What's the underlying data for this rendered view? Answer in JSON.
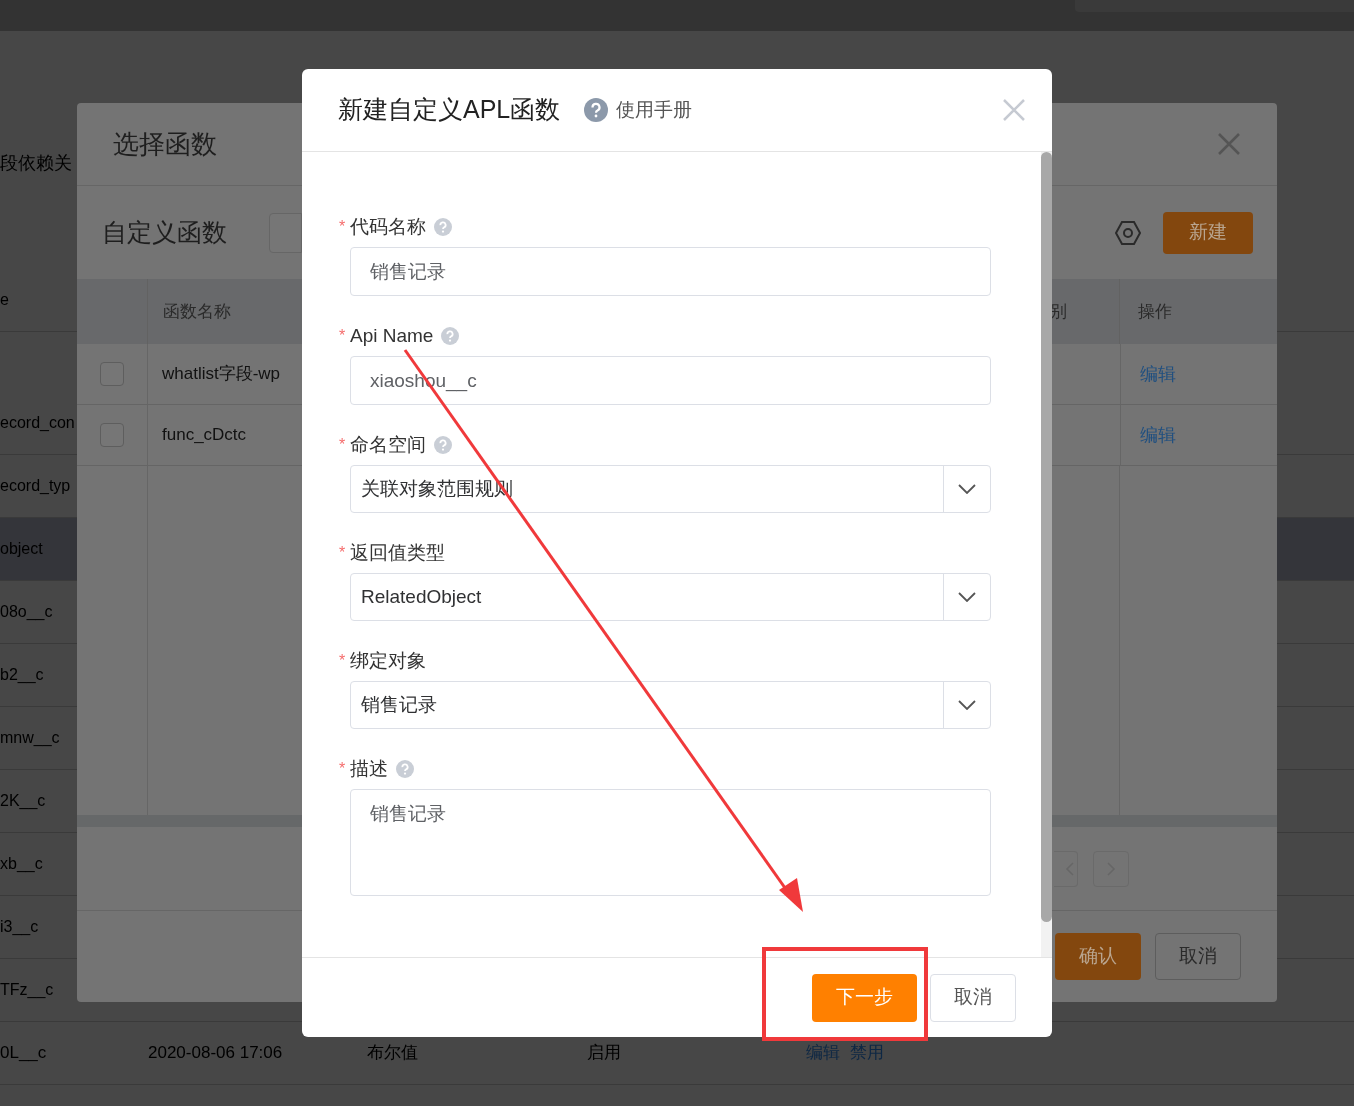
{
  "background_page": {
    "heading_fragment": "段依赖关",
    "rows": [
      {
        "text": "e",
        "selected": false
      },
      {
        "text": "ecord_con",
        "selected": false
      },
      {
        "text": "ecord_typ",
        "selected": false
      },
      {
        "text": "object",
        "selected": true
      },
      {
        "text": "08o__c",
        "selected": false
      },
      {
        "text": "b2__c",
        "selected": false
      },
      {
        "text": "mnw__c",
        "selected": false
      },
      {
        "text": "2K__c",
        "selected": false
      },
      {
        "text": "xb__c",
        "selected": false
      },
      {
        "text": "i3__c",
        "selected": false
      },
      {
        "text": "TFz__c",
        "selected": false
      }
    ],
    "bottom_row": {
      "name": "0L__c",
      "time": "2020-08-06 17:06",
      "type": "布尔值",
      "status": "启用",
      "actions": [
        "编辑",
        "禁用"
      ]
    }
  },
  "select_function_dialog": {
    "title": "选择函数",
    "section_title": "自定义函数",
    "new_button": "新建",
    "columns": [
      "函数名称",
      "别",
      "操作"
    ],
    "rows": [
      {
        "name": "whatlist字段-wp",
        "action": "编辑",
        "checked": false
      },
      {
        "name": "func_cDctc",
        "action": "编辑",
        "checked": false
      }
    ],
    "buttons": [
      "确认",
      "取消"
    ]
  },
  "create_dialog": {
    "title": "新建自定义APL函数",
    "help_link": "使用手册",
    "fields": [
      {
        "kind": "input",
        "required_mark": "*",
        "label": "代码名称",
        "help": true,
        "value": "销售记录"
      },
      {
        "kind": "input",
        "required_mark": "*",
        "label": "Api Name",
        "help": true,
        "value": "xiaoshou__c"
      },
      {
        "kind": "select",
        "required_mark": "*",
        "label": "命名空间",
        "help": true,
        "value": "关联对象范围规则"
      },
      {
        "kind": "select",
        "required_mark": "*",
        "label": "返回值类型",
        "help": false,
        "value": "RelatedObject"
      },
      {
        "kind": "select",
        "required_mark": "*",
        "label": "绑定对象",
        "help": false,
        "value": "销售记录"
      },
      {
        "kind": "textarea",
        "required_mark": "*",
        "label": "描述",
        "help": true,
        "value": "销售记录"
      }
    ],
    "buttons": [
      {
        "label": "下一步",
        "kind": "primary"
      },
      {
        "label": "取消",
        "kind": "default"
      }
    ]
  }
}
